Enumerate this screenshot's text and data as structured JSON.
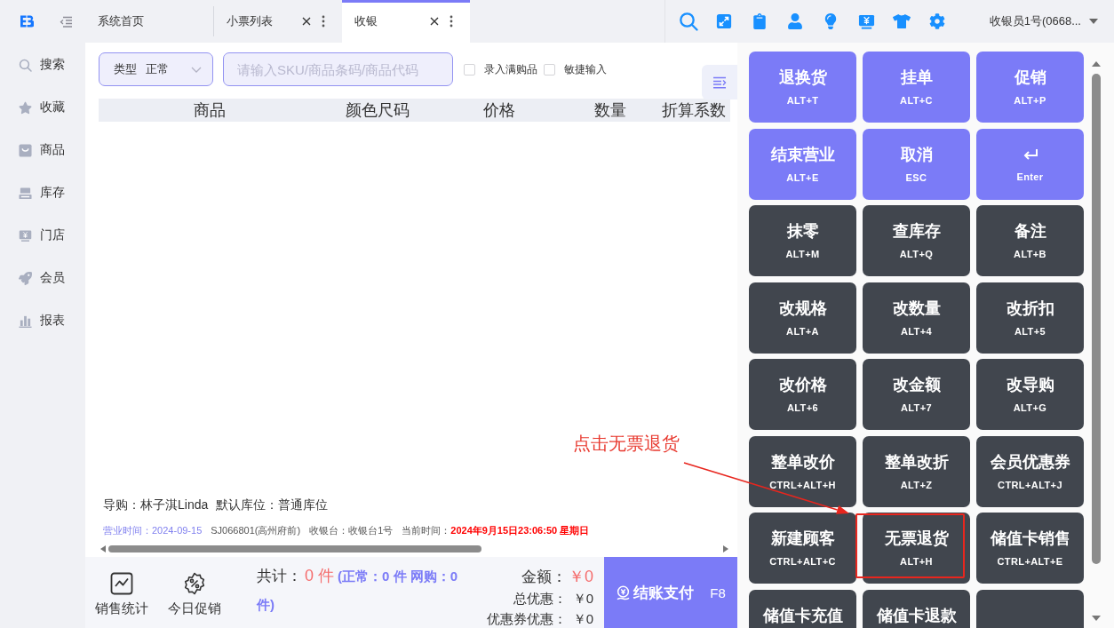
{
  "top_bar": {
    "tabs": [
      {
        "label": "系统首页",
        "selected": false,
        "closable": false
      },
      {
        "label": "小票列表",
        "selected": false,
        "closable": true
      },
      {
        "label": "收银",
        "selected": true,
        "closable": true
      }
    ],
    "user": "收银员1号(0668..."
  },
  "sidebar": {
    "items": [
      {
        "label": "搜索"
      },
      {
        "label": "收藏"
      },
      {
        "label": "商品"
      },
      {
        "label": "库存"
      },
      {
        "label": "门店"
      },
      {
        "label": "会员"
      },
      {
        "label": "报表"
      }
    ]
  },
  "toolbar": {
    "type_select": {
      "label": "类型",
      "value": "正常"
    },
    "search": {
      "placeholder": "请输入SKU/商品条码/商品代码"
    },
    "checkboxes": [
      {
        "label": "录入满购品",
        "checked": false
      },
      {
        "label": "敏捷输入",
        "checked": false
      }
    ]
  },
  "table": {
    "columns": [
      "商品",
      "颜色尺码",
      "价格",
      "数量",
      "折算系数"
    ]
  },
  "info": {
    "salesperson": "导购：林子淇Linda",
    "default_location": "默认库位：普通库位",
    "business_date": "营业时间：2024-09-15",
    "store": "SJ066801(高州府前)",
    "register": "收银台：收银台1号",
    "current_time_label": "当前时间：",
    "current_time": "2024年9月15日23:06:50 星期日"
  },
  "bottom_bar": {
    "actions": [
      {
        "label": "销售统计"
      },
      {
        "label": "今日促销"
      }
    ],
    "total_label": "共计：",
    "total_count": "0 件",
    "total_breakdown": "(正常：0 件 网购：0 件)",
    "amounts": [
      {
        "kind": "main",
        "label": "金额：",
        "value": "￥0"
      },
      {
        "kind": "sub",
        "label": "总优惠：",
        "value": "￥0"
      },
      {
        "kind": "sub",
        "label": "优惠券优惠：",
        "value": "￥0"
      }
    ],
    "pay_button": {
      "label": "结账支付",
      "shortcut": "F8"
    }
  },
  "shortcut_buttons": [
    {
      "kind": "primary",
      "label": "退换货",
      "shortcut": "ALT+T",
      "highlighted": false
    },
    {
      "kind": "primary",
      "label": "挂单",
      "shortcut": "ALT+C",
      "highlighted": false
    },
    {
      "kind": "primary",
      "label": "促销",
      "shortcut": "ALT+P",
      "highlighted": false
    },
    {
      "kind": "primary",
      "label": "结束营业",
      "shortcut": "ALT+E",
      "highlighted": false
    },
    {
      "kind": "primary",
      "label": "取消",
      "shortcut": "ESC",
      "highlighted": false
    },
    {
      "kind": "enter",
      "shortcut": "Enter",
      "highlighted": false
    },
    {
      "kind": "dark",
      "label": "抹零",
      "shortcut": "ALT+M",
      "highlighted": false
    },
    {
      "kind": "dark",
      "label": "查库存",
      "shortcut": "ALT+Q",
      "highlighted": false
    },
    {
      "kind": "dark",
      "label": "备注",
      "shortcut": "ALT+B",
      "highlighted": false
    },
    {
      "kind": "dark",
      "label": "改规格",
      "shortcut": "ALT+A",
      "highlighted": false
    },
    {
      "kind": "dark",
      "label": "改数量",
      "shortcut": "ALT+4",
      "highlighted": false
    },
    {
      "kind": "dark",
      "label": "改折扣",
      "shortcut": "ALT+5",
      "highlighted": false
    },
    {
      "kind": "dark",
      "label": "改价格",
      "shortcut": "ALT+6",
      "highlighted": false
    },
    {
      "kind": "dark",
      "label": "改金额",
      "shortcut": "ALT+7",
      "highlighted": false
    },
    {
      "kind": "dark",
      "label": "改导购",
      "shortcut": "ALT+G",
      "highlighted": false
    },
    {
      "kind": "dark",
      "label": "整单改价",
      "shortcut": "CTRL+ALT+H",
      "highlighted": false
    },
    {
      "kind": "dark",
      "label": "整单改折",
      "shortcut": "ALT+Z",
      "highlighted": false
    },
    {
      "kind": "dark",
      "label": "会员优惠券",
      "shortcut": "CTRL+ALT+J",
      "highlighted": false
    },
    {
      "kind": "dark",
      "label": "新建顾客",
      "shortcut": "CTRL+ALT+C",
      "highlighted": false
    },
    {
      "kind": "dark",
      "label": "无票退货",
      "shortcut": "ALT+H",
      "highlighted": true
    },
    {
      "kind": "dark",
      "label": "储值卡销售",
      "shortcut": "CTRL+ALT+E",
      "highlighted": false
    },
    {
      "kind": "dark",
      "label": "储值卡充值",
      "highlighted": false
    },
    {
      "kind": "dark",
      "label": "储值卡退款",
      "highlighted": false
    },
    {
      "kind": "blank",
      "highlighted": false
    }
  ],
  "annotation": {
    "text": "点击无票退货"
  }
}
